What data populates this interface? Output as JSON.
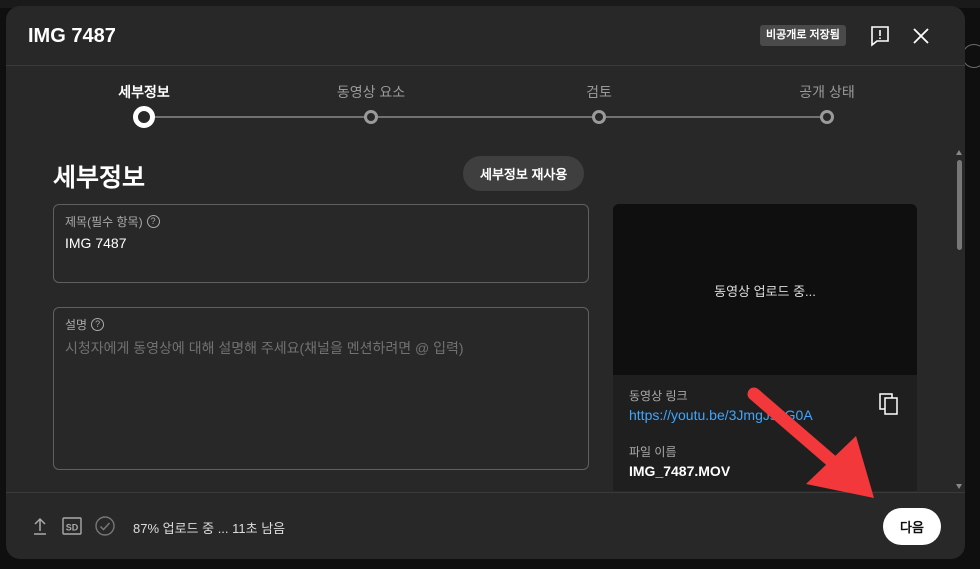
{
  "header": {
    "title": "IMG 7487",
    "saved_badge": "비공개로 저장됨"
  },
  "steps": [
    {
      "label": "세부정보",
      "active": true
    },
    {
      "label": "동영상 요소",
      "active": false
    },
    {
      "label": "검토",
      "active": false
    },
    {
      "label": "공개 상태",
      "active": false
    }
  ],
  "details": {
    "section_title": "세부정보",
    "reuse_button": "세부정보 재사용",
    "title_field": {
      "label": "제목(필수 항목)",
      "value": "IMG 7487"
    },
    "description_field": {
      "label": "설명",
      "placeholder": "시청자에게 동영상에 대해 설명해 주세요(채널을 멘션하려면 @ 입력)"
    }
  },
  "preview": {
    "status": "동영상 업로드 중...",
    "link_label": "동영상 링크",
    "link": "https://youtu.be/3JmgJspG0A",
    "filename_label": "파일 이름",
    "filename": "IMG_7487.MOV"
  },
  "footer": {
    "upload_status": "87% 업로드 중 ... 11초 남음",
    "sd_badge": "SD",
    "next_button": "다음"
  },
  "colors": {
    "dialog_bg": "#282828",
    "link": "#3ea6ff",
    "annotation_arrow": "#f2383a"
  }
}
